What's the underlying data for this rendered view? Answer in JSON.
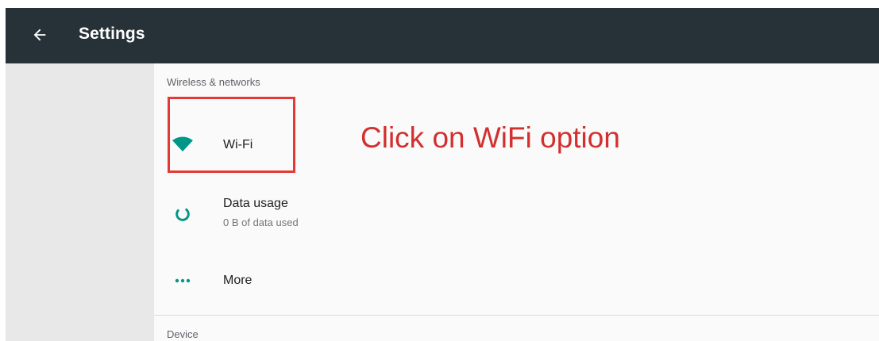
{
  "appbar": {
    "title": "Settings",
    "back_icon": "arrow-back-icon",
    "background": "#263238"
  },
  "sections": {
    "wireless_header": "Wireless & networks",
    "device_header": "Device"
  },
  "items": [
    {
      "label": "Wi-Fi",
      "summary": "",
      "icon": "wifi-icon"
    },
    {
      "label": "Data usage",
      "summary": "0 B of data used",
      "icon": "data-usage-icon"
    },
    {
      "label": "More",
      "summary": "",
      "icon": "more-horiz-icon"
    }
  ],
  "annotation": {
    "text": "Click on WiFi option",
    "color": "#d32f2f"
  },
  "accent": "#009688"
}
